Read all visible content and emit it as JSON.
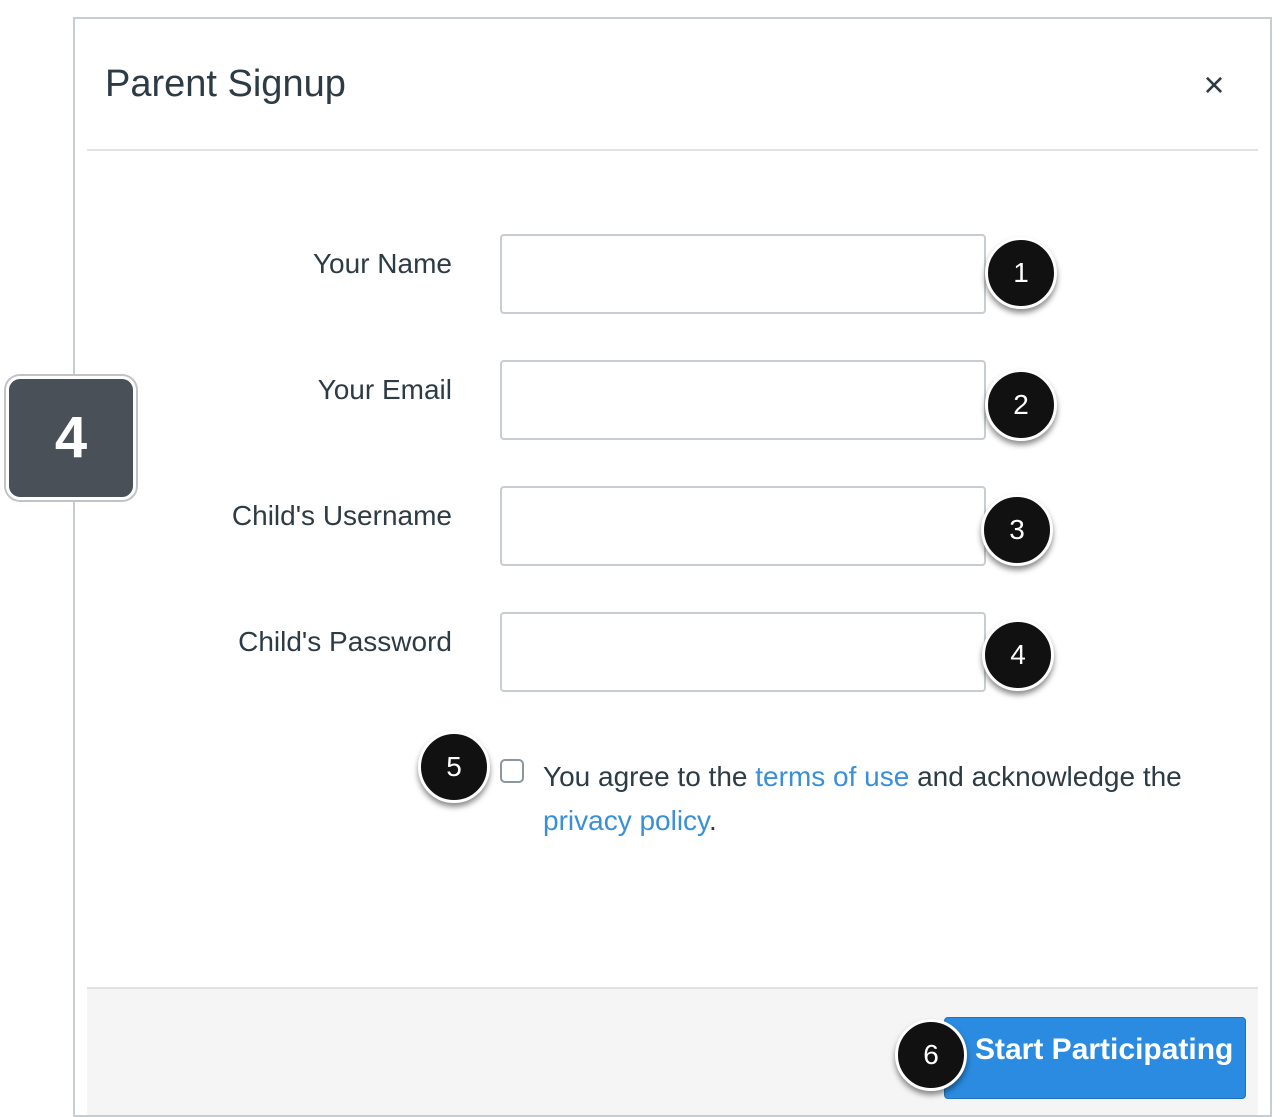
{
  "step_badge": "4",
  "dialog": {
    "title": "Parent Signup",
    "close_icon": "×"
  },
  "form": {
    "fields": [
      {
        "label": "Your Name",
        "value": "",
        "callout": "1"
      },
      {
        "label": "Your Email",
        "value": "",
        "callout": "2"
      },
      {
        "label": "Child's Username",
        "value": "",
        "callout": "3"
      },
      {
        "label": "Child's Password",
        "value": "",
        "callout": "4"
      }
    ],
    "agreement": {
      "callout": "5",
      "checked": false,
      "text_before": "You agree to the ",
      "terms_link": "terms of use",
      "text_middle": " and acknowledge the ",
      "privacy_link": "privacy policy",
      "text_after": "."
    }
  },
  "footer": {
    "submit_label": "Start Participating",
    "callout": "6"
  },
  "colors": {
    "link": "#3a8fd9",
    "primary_button": "#2a8be0",
    "text": "#2d3b45",
    "badge": "#4a5057"
  }
}
